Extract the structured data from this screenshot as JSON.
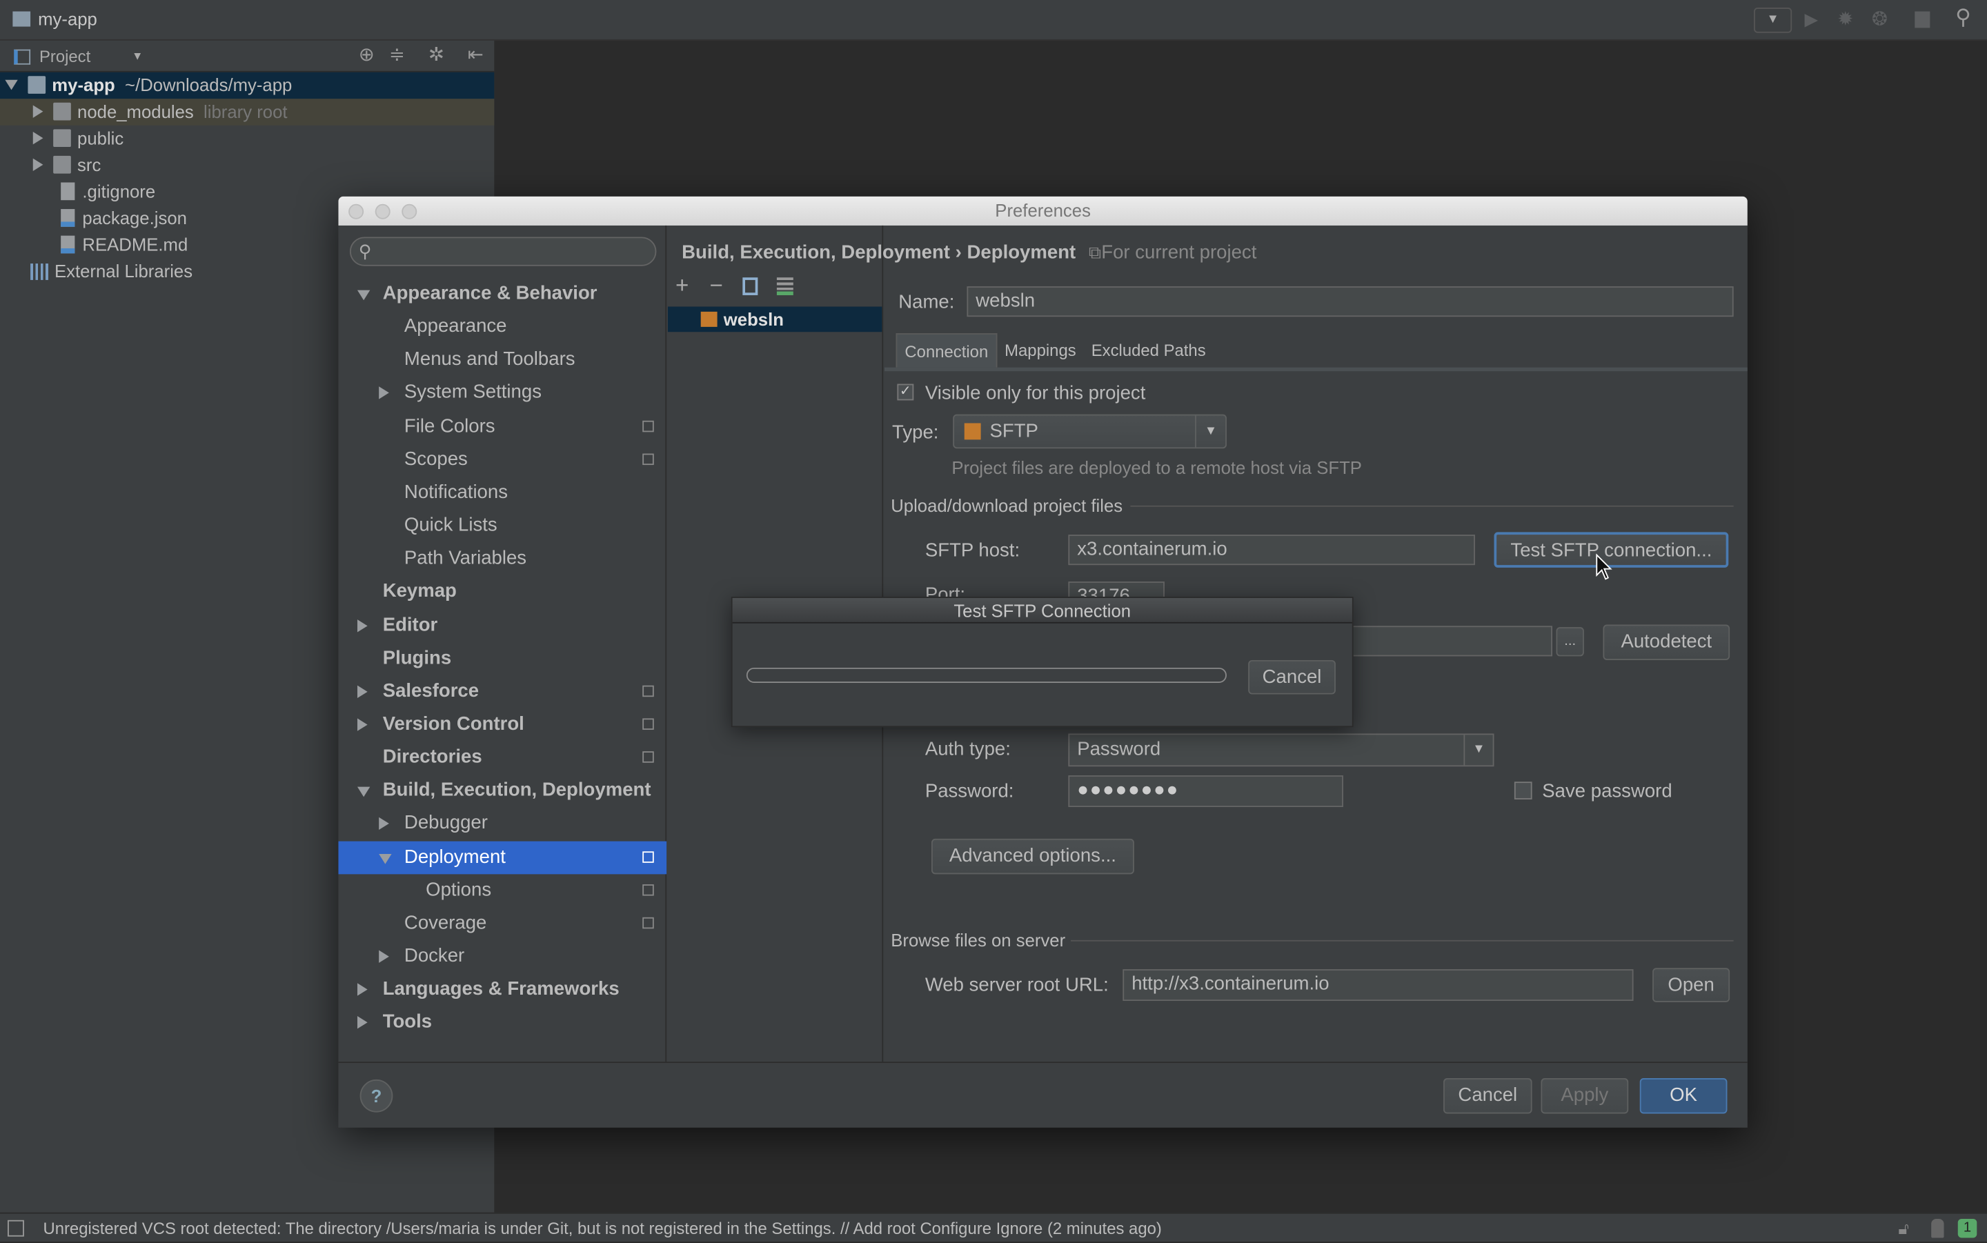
{
  "topbar": {
    "project": "my-app"
  },
  "project_panel": {
    "view": "Project",
    "tree": [
      {
        "name": "my-app",
        "extra": "~/Downloads/my-app",
        "kind": "folder",
        "expanded": true,
        "selected": true
      },
      {
        "name": "node_modules",
        "extra": "library root",
        "kind": "folder"
      },
      {
        "name": "public",
        "kind": "folder"
      },
      {
        "name": "src",
        "kind": "folder"
      },
      {
        "name": ".gitignore",
        "kind": "file"
      },
      {
        "name": "package.json",
        "kind": "file"
      },
      {
        "name": "README.md",
        "kind": "file"
      },
      {
        "name": "External Libraries",
        "kind": "library"
      }
    ]
  },
  "preferences": {
    "title": "Preferences",
    "search_placeholder": "",
    "nav": [
      {
        "label": "Appearance & Behavior",
        "bold": true,
        "arrow": "down",
        "level": 0
      },
      {
        "label": "Appearance",
        "level": 1
      },
      {
        "label": "Menus and Toolbars",
        "level": 1
      },
      {
        "label": "System Settings",
        "level": 1,
        "arrow": "right"
      },
      {
        "label": "File Colors",
        "level": 1,
        "project": true
      },
      {
        "label": "Scopes",
        "level": 1,
        "project": true
      },
      {
        "label": "Notifications",
        "level": 1
      },
      {
        "label": "Quick Lists",
        "level": 1
      },
      {
        "label": "Path Variables",
        "level": 1
      },
      {
        "label": "Keymap",
        "bold": true,
        "level": 0
      },
      {
        "label": "Editor",
        "bold": true,
        "arrow": "right",
        "level": 0
      },
      {
        "label": "Plugins",
        "bold": true,
        "level": 0
      },
      {
        "label": "Salesforce",
        "bold": true,
        "arrow": "right",
        "level": 0,
        "project": true
      },
      {
        "label": "Version Control",
        "bold": true,
        "arrow": "right",
        "level": 0,
        "project": true
      },
      {
        "label": "Directories",
        "bold": true,
        "level": 0,
        "project": true
      },
      {
        "label": "Build, Execution, Deployment",
        "bold": true,
        "arrow": "down",
        "level": 0
      },
      {
        "label": "Debugger",
        "level": 1,
        "arrow": "right"
      },
      {
        "label": "Deployment",
        "level": 1,
        "arrow": "down",
        "selected": true,
        "project": true
      },
      {
        "label": "Options",
        "level": 2,
        "project": true
      },
      {
        "label": "Coverage",
        "level": 1,
        "project": true
      },
      {
        "label": "Docker",
        "level": 1,
        "arrow": "right"
      },
      {
        "label": "Languages & Frameworks",
        "bold": true,
        "arrow": "right",
        "level": 0
      },
      {
        "label": "Tools",
        "bold": true,
        "arrow": "right",
        "level": 0
      }
    ],
    "breadcrumb": {
      "parent": "Build, Execution, Deployment",
      "sep": "›",
      "current": "Deployment",
      "scope": "For current project"
    },
    "servers": [
      {
        "name": "websln",
        "selected": true
      }
    ],
    "name_label": "Name:",
    "name_value": "websln",
    "tabs": [
      {
        "label": "Connection",
        "active": true
      },
      {
        "label": "Mappings"
      },
      {
        "label": "Excluded Paths"
      }
    ],
    "visible_only": {
      "label": "Visible only for this project",
      "checked": true
    },
    "type_label": "Type:",
    "type_value": "SFTP",
    "type_hint": "Project files are deployed to a remote host via SFTP",
    "upload_section": "Upload/download project files",
    "sftp_host_label": "SFTP host:",
    "sftp_host_value": "x3.containerum.io",
    "test_button": "Test SFTP connection...",
    "port_label": "Port:",
    "port_value": "33176",
    "browse_button": "...",
    "autodetect_button": "Autodetect",
    "auth_type_label": "Auth type:",
    "auth_type_value": "Password",
    "password_label": "Password:",
    "password_value": "●●●●●●●●",
    "save_password": {
      "label": "Save password",
      "checked": false
    },
    "advanced_button": "Advanced options...",
    "browse_section": "Browse files on server",
    "web_root_label": "Web server root URL:",
    "web_root_value": "http://x3.containerum.io",
    "open_button": "Open",
    "help": "?",
    "cancel": "Cancel",
    "apply": "Apply",
    "ok": "OK"
  },
  "test_dialog": {
    "title": "Test SFTP Connection",
    "progress": 0,
    "cancel": "Cancel"
  },
  "status_bar": {
    "message": "Unregistered VCS root detected: The directory /Users/maria is under Git, but is not registered in the Settings. // Add root  Configure  Ignore (2 minutes ago)",
    "notifications": "1"
  },
  "colors": {
    "selection": "#2f65ca",
    "tree_selection": "#0d293e",
    "accent_green": "#59a869",
    "folder_blue": "#4a88c7"
  }
}
